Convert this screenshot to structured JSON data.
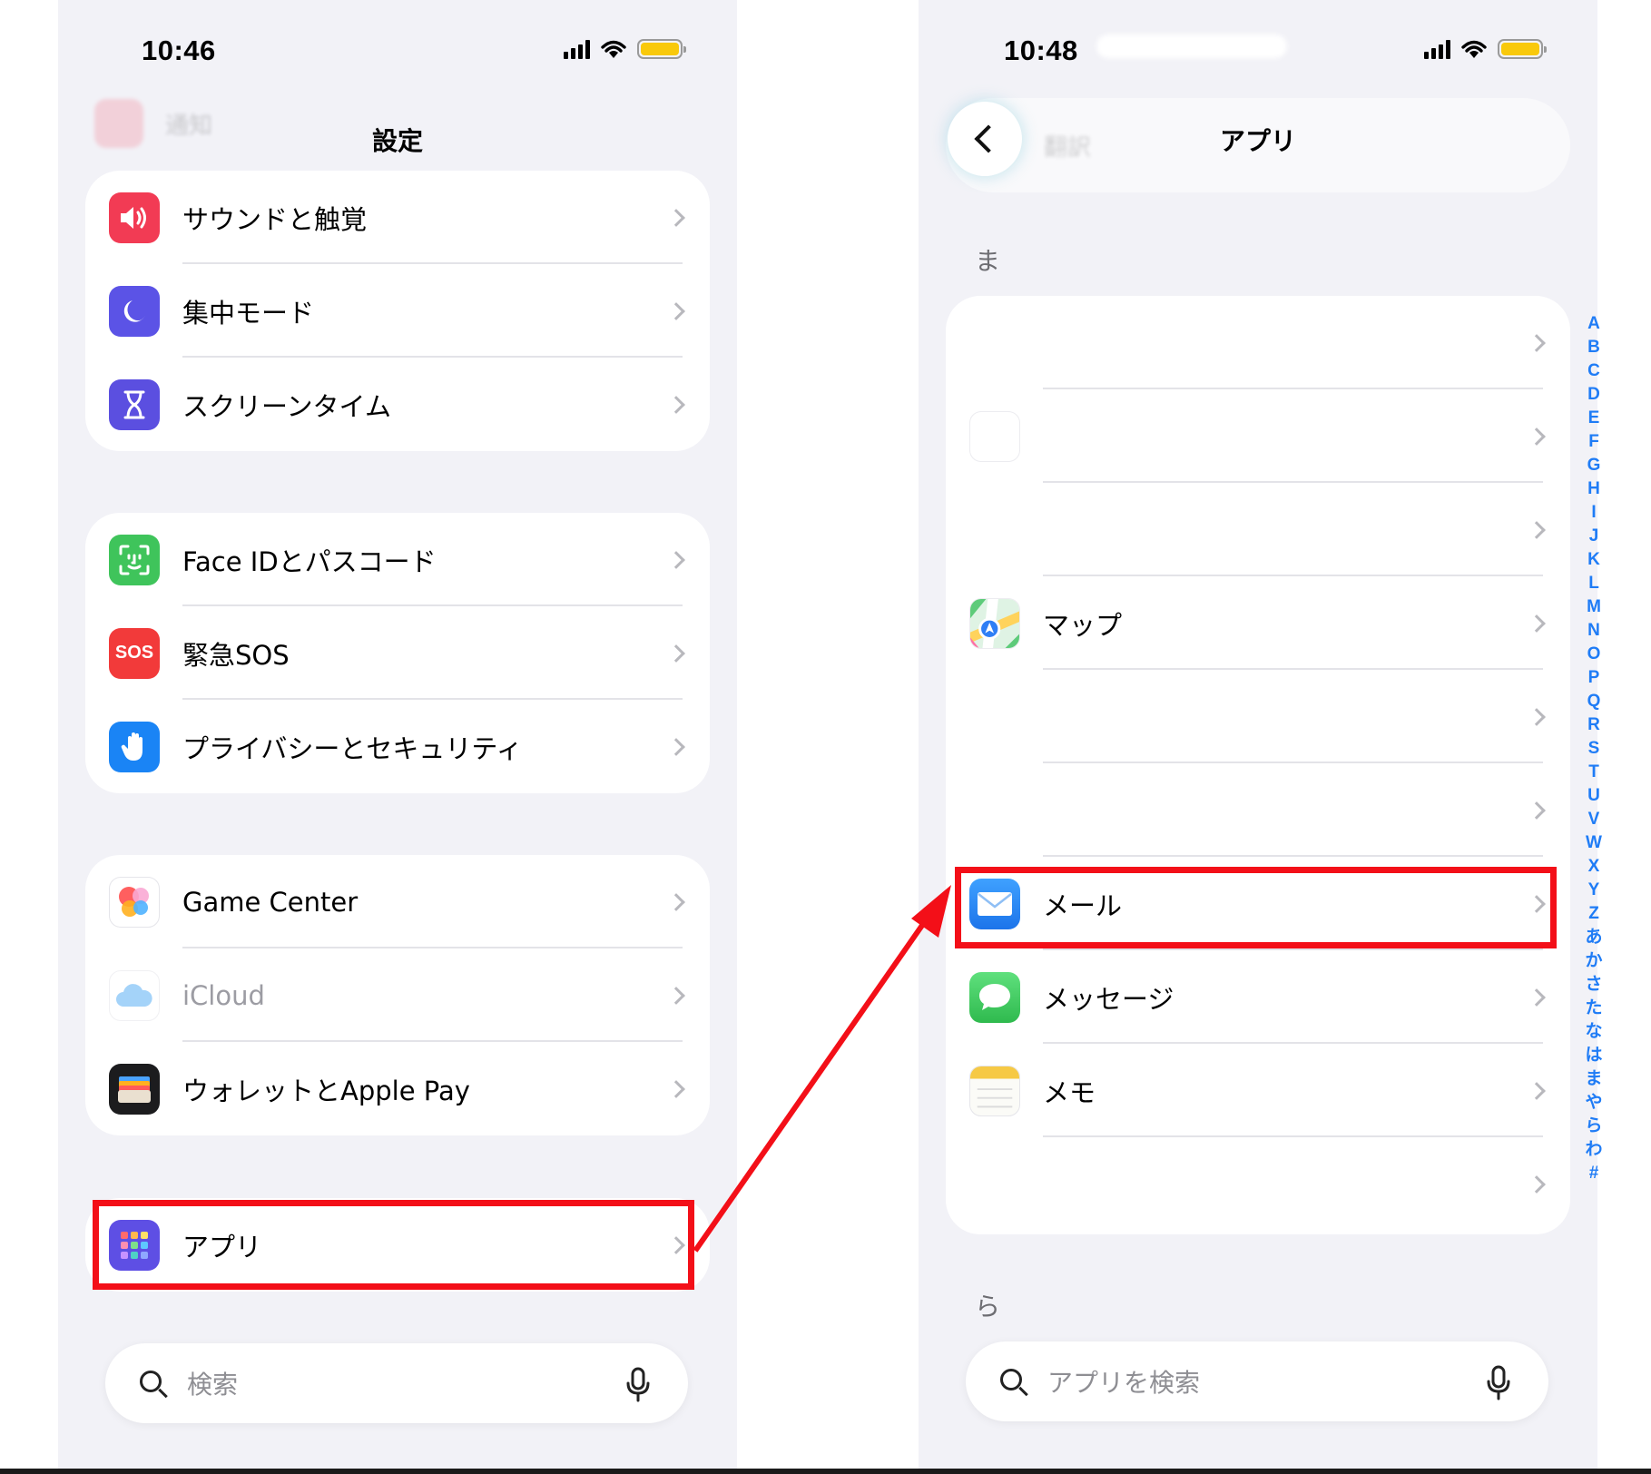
{
  "left": {
    "status": {
      "time": "10:46"
    },
    "ghost_item": "通知",
    "nav_title": "設定",
    "group1": [
      {
        "label": "サウンドと触覚",
        "icon": "speaker-icon",
        "color": "#f23b54"
      },
      {
        "label": "集中モード",
        "icon": "moon-icon",
        "color": "#5b53e6"
      },
      {
        "label": "スクリーンタイム",
        "icon": "hourglass-icon",
        "color": "#5b4fe0"
      }
    ],
    "group2": [
      {
        "label": "Face IDとパスコード",
        "icon": "face-id-icon",
        "color": "#3fc45b"
      },
      {
        "label": "緊急SOS",
        "icon": "sos-icon",
        "color": "#f23a3a",
        "badge": "SOS"
      },
      {
        "label": "プライバシーとセキュリティ",
        "icon": "hand-icon",
        "color": "#1a84f5"
      }
    ],
    "group3": [
      {
        "label": "Game Center",
        "icon": "game-center-icon"
      },
      {
        "label": "iCloud",
        "icon": "cloud-icon"
      },
      {
        "label": "ウォレットとApple Pay",
        "icon": "wallet-icon",
        "color": "#1c1c1e"
      }
    ],
    "apps_row": {
      "label": "アプリ",
      "icon": "apps-grid-icon",
      "color": "#5e4fe4"
    },
    "search": {
      "placeholder": "検索"
    }
  },
  "right": {
    "status": {
      "time": "10:48"
    },
    "ghost_item": "翻訳",
    "nav_title": "アプリ",
    "section_ma": "ま",
    "section_ra": "ら",
    "rows": [
      {
        "label": "",
        "icon": ""
      },
      {
        "label": "",
        "icon": ""
      },
      {
        "label": "",
        "icon": ""
      },
      {
        "label": "マップ",
        "icon": "maps-icon"
      },
      {
        "label": "",
        "icon": ""
      },
      {
        "label": "",
        "icon": ""
      },
      {
        "label": "メール",
        "icon": "mail-icon",
        "color": "#2b8ef7"
      },
      {
        "label": "メッセージ",
        "icon": "messages-icon",
        "color": "#35c75a"
      },
      {
        "label": "メモ",
        "icon": "notes-icon",
        "color": "#f6c945"
      },
      {
        "label": "",
        "icon": ""
      }
    ],
    "search": {
      "placeholder": "アプリを検索"
    },
    "index": [
      "A",
      "B",
      "C",
      "D",
      "E",
      "F",
      "G",
      "H",
      "I",
      "J",
      "K",
      "L",
      "M",
      "N",
      "O",
      "P",
      "Q",
      "R",
      "S",
      "T",
      "U",
      "V",
      "W",
      "X",
      "Y",
      "Z",
      "あ",
      "か",
      "さ",
      "た",
      "な",
      "は",
      "ま",
      "や",
      "ら",
      "わ",
      "#"
    ]
  },
  "annotation": {
    "color": "#f30f18"
  }
}
